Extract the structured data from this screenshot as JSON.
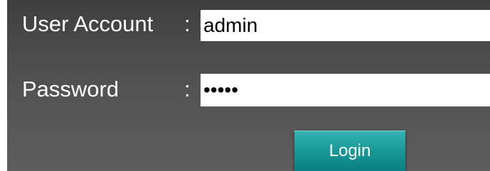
{
  "form": {
    "user_account_label": "User Account",
    "user_account_colon": ":",
    "user_account_value": "admin",
    "password_label": "Password",
    "password_colon": ":",
    "password_value": "admin",
    "login_label": "Login"
  },
  "colors": {
    "panel_background": "#4d4d4d",
    "button_accent": "#1a9a9a",
    "label_text": "#ffffff",
    "field_background": "#ffffff"
  }
}
